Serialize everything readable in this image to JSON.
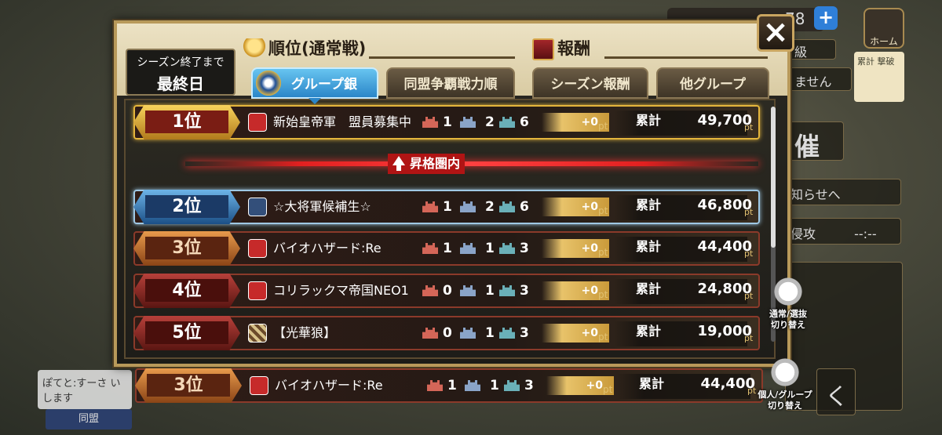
{
  "background": {
    "coins": "78",
    "home_label": "ホーム",
    "side_texts": [
      "級",
      "ません",
      "知らせへ",
      "侵攻",
      "--:--",
      "催",
      "く"
    ],
    "card_text": "累計 撃破",
    "chat_text": "ぽてと:すーさ いします",
    "chat_button": "同盟"
  },
  "modal": {
    "season_label": "シーズン終了まで",
    "season_value": "最終日",
    "ranking_title": "順位(通常戦)",
    "reward_title": "報酬",
    "close_icon": "×",
    "tabs": [
      {
        "label": "グループ銀",
        "active": true
      },
      {
        "label": "同盟争覇戦力順",
        "active": false
      },
      {
        "label": "シーズン報酬",
        "active": false
      },
      {
        "label": "他グループ",
        "active": false
      }
    ],
    "promotion_label": "昇格圏内",
    "total_label": "累計",
    "pt_unit": "pt",
    "rows": [
      {
        "rank": "1位",
        "name": "新始皇帝軍　盟員募集中",
        "c1": "1",
        "c2": "2",
        "c3": "6",
        "pt": "+0",
        "total": "49,700"
      },
      {
        "rank": "2位",
        "name": "☆大将軍候補生☆",
        "c1": "1",
        "c2": "2",
        "c3": "6",
        "pt": "+0",
        "total": "46,800"
      },
      {
        "rank": "3位",
        "name": "バイオハザード:Re",
        "c1": "1",
        "c2": "1",
        "c3": "3",
        "pt": "+0",
        "total": "44,400"
      },
      {
        "rank": "4位",
        "name": "コリラックマ帝国NEO1",
        "c1": "0",
        "c2": "1",
        "c3": "3",
        "pt": "+0",
        "total": "24,800"
      },
      {
        "rank": "5位",
        "name": "【光華狼】",
        "c1": "0",
        "c2": "1",
        "c3": "3",
        "pt": "+0",
        "total": "19,000"
      }
    ],
    "my_row": {
      "rank": "3位",
      "name": "バイオハザード:Re",
      "c1": "1",
      "c2": "1",
      "c3": "3",
      "pt": "+0",
      "total": "44,400"
    }
  },
  "side_buttons": {
    "mode_switch": [
      "通常/選抜",
      "切り替え"
    ],
    "scope_switch": [
      "個人/グループ",
      "切り替え"
    ]
  },
  "colors": {
    "gold": "#e4b53c",
    "silver": "#9fc8e4",
    "promo_red": "#e22020",
    "tab_active": "#2b86c8"
  }
}
